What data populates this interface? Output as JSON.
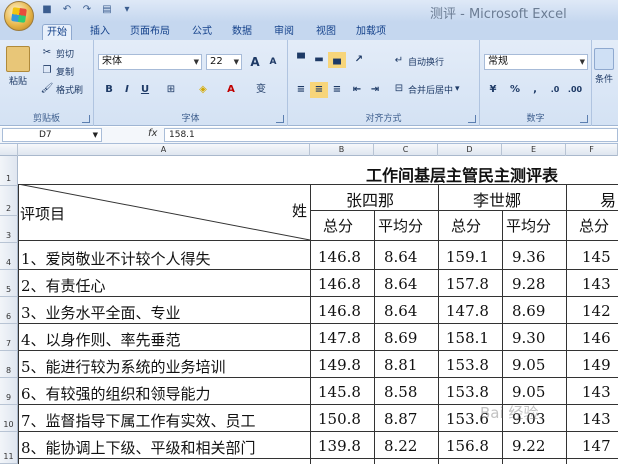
{
  "window": {
    "title": "测评 - Microsoft Excel"
  },
  "quick_access": {
    "icons": [
      "save-icon",
      "undo-icon",
      "redo-icon",
      "print-preview-icon"
    ]
  },
  "tabs": [
    "开始",
    "插入",
    "页面布局",
    "公式",
    "数据",
    "审阅",
    "视图",
    "加载项"
  ],
  "ribbon": {
    "clipboard": {
      "paste": "粘贴",
      "cut": "剪切",
      "copy": "复制",
      "format_painter": "格式刷",
      "label": "剪贴板"
    },
    "font": {
      "name": "宋体",
      "size": "22",
      "bold": "B",
      "italic": "I",
      "underline": "U",
      "grow": "A",
      "shrink": "A",
      "label": "字体"
    },
    "alignment": {
      "wrap": "自动换行",
      "merge": "合并后居中",
      "label": "对齐方式"
    },
    "number": {
      "format": "常规",
      "percent": "%",
      "comma": ",",
      "label": "数字"
    },
    "styles": {
      "conditional": "条件"
    }
  },
  "formula_bar": {
    "name_box": "D7",
    "fx": "fx",
    "value": "158.1"
  },
  "columns": [
    "A",
    "B",
    "C",
    "D",
    "E",
    "F"
  ],
  "row_numbers": [
    "1",
    "2",
    "3",
    "4",
    "5",
    "6",
    "7",
    "8",
    "9",
    "10",
    "11"
  ],
  "sheet": {
    "title": "工作间基层主管民主测评表",
    "item_header": "评项目",
    "name_header": "姓",
    "persons": [
      "张四那",
      "李世娜",
      "易"
    ],
    "sub_total": "总分",
    "sub_avg": "平均分",
    "rows": [
      {
        "item": "1、爱岗敬业不计较个人得失",
        "b": "146.8",
        "c": "8.64",
        "d": "159.1",
        "e": "9.36",
        "f": "145"
      },
      {
        "item": "2、有责任心",
        "b": "146.8",
        "c": "8.64",
        "d": "157.8",
        "e": "9.28",
        "f": "143"
      },
      {
        "item": "3、业务水平全面、专业",
        "b": "146.8",
        "c": "8.64",
        "d": "147.8",
        "e": "8.69",
        "f": "142"
      },
      {
        "item": "4、以身作则、率先垂范",
        "b": "147.8",
        "c": "8.69",
        "d": "158.1",
        "e": "9.30",
        "f": "146"
      },
      {
        "item": "5、能进行较为系统的业务培训",
        "b": "149.8",
        "c": "8.81",
        "d": "153.8",
        "e": "9.05",
        "f": "149"
      },
      {
        "item": "6、有较强的组织和领导能力",
        "b": "145.8",
        "c": "8.58",
        "d": "153.8",
        "e": "9.05",
        "f": "143"
      },
      {
        "item": "7、监督指导下属工作有实效、员工",
        "b": "150.8",
        "c": "8.87",
        "d": "153.6",
        "e": "9.03",
        "f": "143"
      },
      {
        "item": "8、能协调上下级、平级和相关部门",
        "b": "139.8",
        "c": "8.22",
        "d": "156.8",
        "e": "9.22",
        "f": "147"
      }
    ]
  },
  "watermark": "Bai 经验"
}
